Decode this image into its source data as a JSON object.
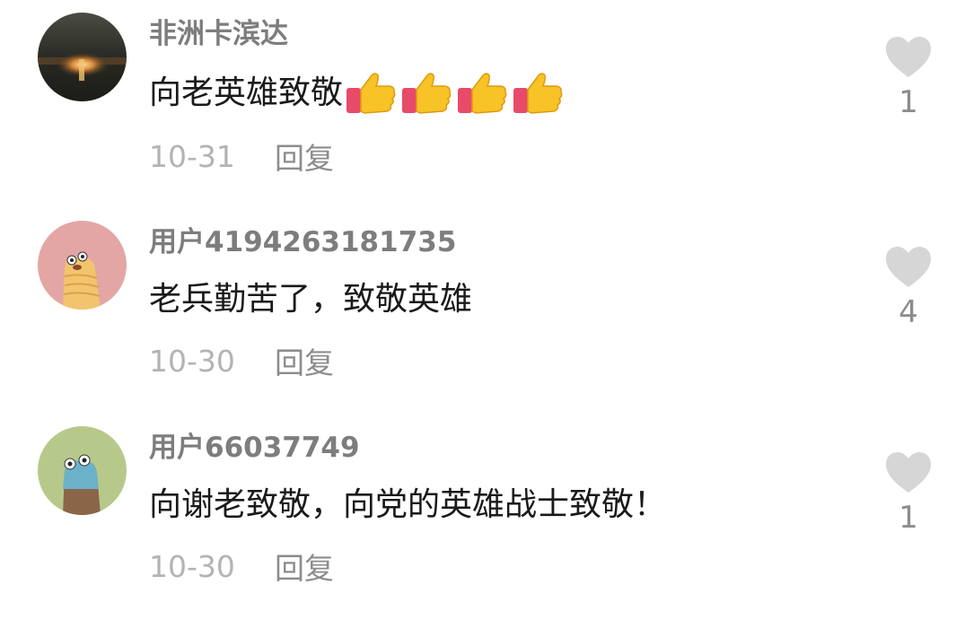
{
  "comments": [
    {
      "username": "非洲卡滨达",
      "text": "向老英雄致敬",
      "emoji_count": 4,
      "emoji": "thumbs-up",
      "date": "10-31",
      "reply_label": "回复",
      "likes": "1"
    },
    {
      "username": "用户4194263181735",
      "text": "老兵勤苦了，致敬英雄",
      "date": "10-30",
      "reply_label": "回复",
      "likes": "4"
    },
    {
      "username": "用户66037749",
      "text": "向谢老致敬，向党的英雄战士致敬！",
      "date": "10-30",
      "reply_label": "回复",
      "likes": "1"
    }
  ],
  "colors": {
    "username": "#7d7d7d",
    "text": "#1a1a1a",
    "date": "#b3b3b3",
    "reply": "#8c8c8c",
    "heart": "#d6d6d6"
  }
}
